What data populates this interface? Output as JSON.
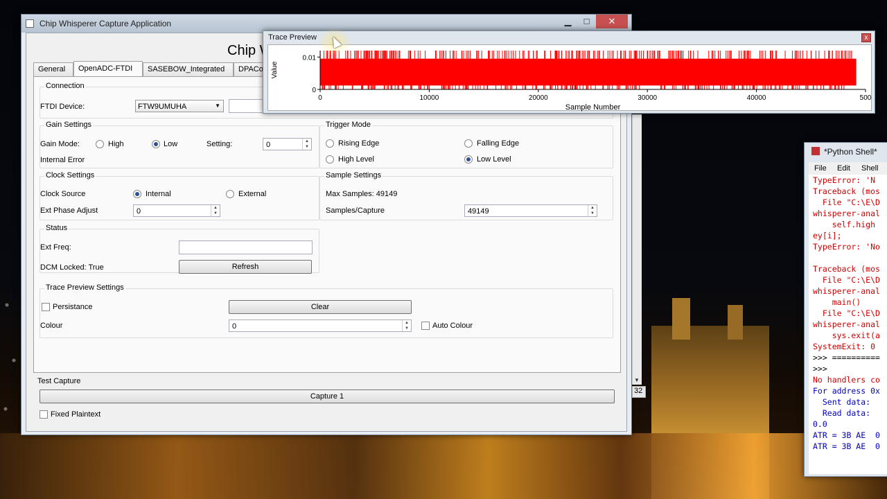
{
  "main_window": {
    "title": "Chip Whisperer Capture Application",
    "controls": {
      "minimize": "▁",
      "maximize": "□",
      "close": "✕"
    },
    "heading": "Chip W",
    "tabs": [
      {
        "label": "General"
      },
      {
        "label": "OpenADC-FTDI"
      },
      {
        "label": "SASEBOW_Integrated"
      },
      {
        "label": "DPACo"
      }
    ],
    "connection": {
      "title": "Connection",
      "ftdi_label": "FTDI Device:",
      "ftdi_value": "FTW9UMUHA"
    },
    "gain": {
      "title": "Gain Settings",
      "mode_label": "Gain Mode:",
      "high": "High",
      "low": "Low",
      "setting_label": "Setting:",
      "setting_value": "0",
      "error_label": "Internal Error"
    },
    "trigger": {
      "title": "Trigger Mode",
      "rising": "Rising Edge",
      "falling": "Falling Edge",
      "high": "High Level",
      "low": "Low Level"
    },
    "clock": {
      "title": "Clock Settings",
      "source_label": "Clock Source",
      "internal": "Internal",
      "external": "External",
      "phase_label": "Ext Phase Adjust",
      "phase_value": "0"
    },
    "sample": {
      "title": "Sample Settings",
      "max_samples": "Max Samples: 49149",
      "per_capture_label": "Samples/Capture",
      "per_capture_value": "49149"
    },
    "status": {
      "title": "Status",
      "freq_label": "Ext Freq:",
      "dcm_label": "DCM Locked: True",
      "refresh": "Refresh"
    },
    "trace_settings": {
      "title": "Trace Preview Settings",
      "persistance": "Persistance",
      "clear": "Clear",
      "colour_label": "Colour",
      "colour_value": "0",
      "auto_colour": "Auto Colour"
    },
    "test_capture": {
      "title": "Test Capture",
      "capture_button": "Capture 1",
      "fixed_plaintext": "Fixed Plaintext"
    },
    "partial_value": "32"
  },
  "trace_window": {
    "title": "Trace Preview",
    "close": "x"
  },
  "chart_data": {
    "type": "line",
    "title": "",
    "xlabel": "Sample Number",
    "ylabel": "Value",
    "xlim": [
      0,
      50000
    ],
    "ylim": [
      0,
      0.012
    ],
    "x_ticks": [
      "0",
      "10000",
      "20000",
      "30000",
      "40000",
      "500"
    ],
    "y_ticks": [
      "0.01",
      "0"
    ],
    "series": [
      {
        "color": "#ff0000",
        "x_range": [
          0,
          49149
        ],
        "y_range": [
          0,
          0.012
        ]
      }
    ]
  },
  "shell_window": {
    "title": "*Python Shell*",
    "menu": [
      "File",
      "Edit",
      "Shell"
    ],
    "lines": [
      {
        "text": "TypeError: 'N",
        "color": "red"
      },
      {
        "text": "Traceback (mos",
        "color": "red"
      },
      {
        "text": "  File \"C:\\E\\D",
        "color": "red"
      },
      {
        "text": "whisperer-anal",
        "color": "red"
      },
      {
        "text": "    self.high",
        "color": "red"
      },
      {
        "text": "ey[i];",
        "color": "red"
      },
      {
        "text": "TypeError: 'No",
        "color": "red"
      },
      {
        "text": "",
        "color": "red"
      },
      {
        "text": "Traceback (mos",
        "color": "red"
      },
      {
        "text": "  File \"C:\\E\\D",
        "color": "red"
      },
      {
        "text": "whisperer-anal",
        "color": "red"
      },
      {
        "text": "    main()",
        "color": "red"
      },
      {
        "text": "  File \"C:\\E\\D",
        "color": "red"
      },
      {
        "text": "whisperer-anal",
        "color": "red"
      },
      {
        "text": "    sys.exit(a",
        "color": "red"
      },
      {
        "text": "SystemExit: 0",
        "color": "red"
      },
      {
        "text": ">>> ==========",
        "color": "dark"
      },
      {
        "text": ">>>",
        "color": "dark"
      },
      {
        "text": "No handlers co",
        "color": "red"
      },
      {
        "text": "For address 0x",
        "color": "blue"
      },
      {
        "text": "  Sent data:",
        "color": "blue"
      },
      {
        "text": "  Read data:",
        "color": "blue"
      },
      {
        "text": "0.0",
        "color": "blue"
      },
      {
        "text": "ATR = 3B AE  0",
        "color": "blue"
      },
      {
        "text": "ATR = 3B AE  0",
        "color": "blue"
      }
    ]
  }
}
